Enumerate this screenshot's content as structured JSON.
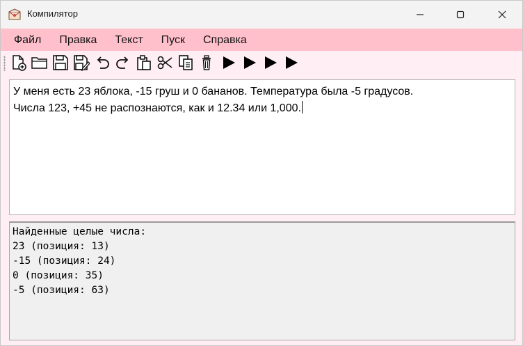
{
  "window": {
    "title": "Компилятор"
  },
  "menu": [
    "Файл",
    "Правка",
    "Текст",
    "Пуск",
    "Справка"
  ],
  "toolbar": {
    "icons": [
      "new-file-icon",
      "open-folder-icon",
      "save-icon",
      "save-as-icon",
      "undo-icon",
      "redo-icon",
      "paste-icon",
      "cut-icon",
      "copy-icon",
      "delete-icon",
      "run-icon",
      "run-icon",
      "run-icon",
      "run-icon"
    ]
  },
  "editor": {
    "lines": [
      "У меня есть 23 яблока, -15 груш и 0 бананов. Температура была -5 градусов.",
      "Числа 123, +45 не распознаются, как и 12.34 или 1,000."
    ]
  },
  "output": {
    "lines": [
      "Найденные целые числа:",
      "23 (позиция: 13)",
      "-15 (позиция: 24)",
      "0 (позиция: 35)",
      "-5 (позиция: 63)"
    ]
  },
  "colors": {
    "menubar": "#ffc0cb",
    "background": "#ffeef3",
    "output": "#f0f0f0"
  }
}
